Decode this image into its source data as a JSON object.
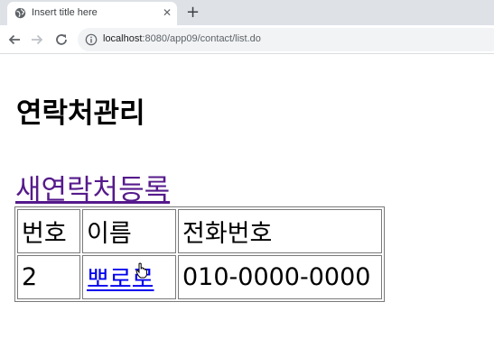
{
  "browser": {
    "tab": {
      "title": "Insert title here",
      "favicon": "globe-icon",
      "close_glyph": "✕"
    },
    "new_tab_glyph": "+",
    "nav": {
      "back": "arrow-left-icon",
      "forward": "arrow-right-icon",
      "reload": "reload-icon"
    },
    "address": {
      "host": "localhost",
      "rest": ":8080/app09/contact/list.do",
      "icon": "info-icon"
    }
  },
  "page": {
    "title": "연락처관리",
    "new_contact_link": "새연락처등록",
    "table": {
      "headers": [
        "번호",
        "이름",
        "전화번호"
      ],
      "rows": [
        {
          "no": "2",
          "name": "뽀로로",
          "phone": "010-0000-0000"
        }
      ]
    }
  },
  "colors": {
    "visited_link": "#551a8b",
    "link": "#0000ee",
    "tabbar": "#dee1e6"
  }
}
